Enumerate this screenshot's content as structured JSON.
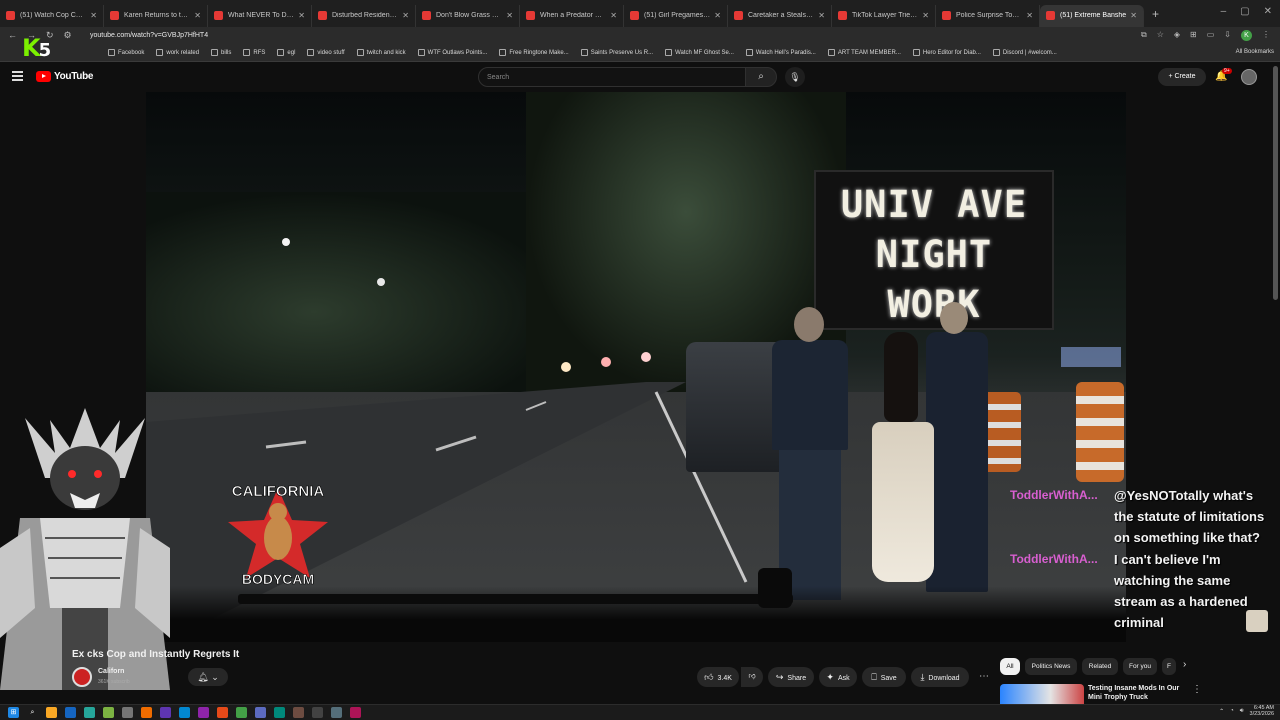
{
  "browser": {
    "tabs": [
      {
        "label": "(51) Watch Cop Cam - Yo"
      },
      {
        "label": "Karen Returns to the Ga"
      },
      {
        "label": "What NEVER To Do Durin"
      },
      {
        "label": "Disturbed Resident Atten"
      },
      {
        "label": "Don't Blow Grass On Her"
      },
      {
        "label": "When a Predator Gets Ca"
      },
      {
        "label": "(51) Girl Pregames Thank"
      },
      {
        "label": "Caretaker a Steals Badge"
      },
      {
        "label": "TikTok Lawyer Tries to Bu"
      },
      {
        "label": "Police Surprise Toxic Coup"
      },
      {
        "label": "(51) Extreme Banshe"
      }
    ],
    "new_tab_label": "+",
    "url": "youtube.com/watch?v=GVBJp7HfHT4",
    "bookmarks": [
      {
        "label": "Facebook"
      },
      {
        "label": "work related"
      },
      {
        "label": "bills"
      },
      {
        "label": "RFS"
      },
      {
        "label": "egl"
      },
      {
        "label": "video stuff"
      },
      {
        "label": "twitch and kick"
      },
      {
        "label": "WTF Outlaws Points..."
      },
      {
        "label": "Free Ringtone Make..."
      },
      {
        "label": "Saints Preserve Us R..."
      },
      {
        "label": "Watch MF Ghost Se..."
      },
      {
        "label": "Watch Hell's Paradis..."
      },
      {
        "label": "ART TEAM MEMBER..."
      },
      {
        "label": "Hero Editor for Diab..."
      },
      {
        "label": "Discord | #welcom..."
      }
    ],
    "all_bookmarks": "All Bookmarks",
    "profile_initial": "K"
  },
  "overlay_logo": {
    "k": "K",
    "five": "5"
  },
  "youtube": {
    "logo_text": "YouTube",
    "search_placeholder": "Search",
    "create_label": "+ Create",
    "notif_count": "9+"
  },
  "video": {
    "sign_lines": [
      "UNIV AVE",
      "NIGHT",
      "WORK"
    ],
    "title": "Ex               cks Cop and Instantly Regrets It",
    "channel": "Californ",
    "subs": "361K subscrib",
    "likes": "3.4K",
    "share": "Share",
    "ask": "Ask",
    "save": "Save",
    "download": "Download",
    "watermark_top": "CALIFORNIA",
    "watermark_bottom": "BODYCAM"
  },
  "chat": {
    "messages": [
      {
        "user": "ToddlerWithA...",
        "text": "@YesNOTotally what's the statute of limitations on something like that?"
      },
      {
        "user": "ToddlerWithA...",
        "text": "I can't believe I'm watching the same stream as a hardened criminal"
      }
    ]
  },
  "sidebar": {
    "chips": [
      {
        "label": "All"
      },
      {
        "label": "Politics News"
      },
      {
        "label": "Related"
      },
      {
        "label": "For you"
      },
      {
        "label": "F"
      }
    ],
    "recommended_title": "Testing Insane Mods In Our Mini Trophy Truck"
  },
  "system": {
    "time": "6:45 AM",
    "date": "3/23/2026"
  }
}
